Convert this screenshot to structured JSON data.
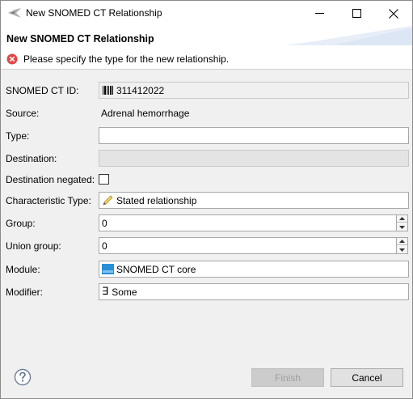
{
  "window": {
    "title": "New SNOMED CT Relationship",
    "app_icon": "snomed-logo-icon",
    "controls": [
      "minimize-icon",
      "maximize-icon",
      "close-icon"
    ]
  },
  "header": {
    "title": "New SNOMED CT Relationship",
    "error_message": "Please specify the type for the new relationship.",
    "error_icon": "error-icon",
    "error_color": "#e04848"
  },
  "form": {
    "id": {
      "label": "SNOMED CT ID:",
      "value": "311412022",
      "icon": "barcode-icon"
    },
    "source": {
      "label": "Source:",
      "value": "Adrenal hemorrhage"
    },
    "type": {
      "label": "Type:",
      "value": ""
    },
    "destination": {
      "label": "Destination:",
      "value": ""
    },
    "destination_negated": {
      "label": "Destination negated:",
      "checked": false
    },
    "characteristic_type": {
      "label": "Characteristic Type:",
      "value": "Stated relationship",
      "icon": "pencil-icon"
    },
    "group": {
      "label": "Group:",
      "value": "0"
    },
    "union_group": {
      "label": "Union group:",
      "value": "0"
    },
    "module": {
      "label": "Module:",
      "value": "SNOMED CT core",
      "icon": "module-icon"
    },
    "modifier": {
      "label": "Modifier:",
      "value": "Some",
      "glyph": "∃"
    }
  },
  "footer": {
    "help_icon": "help-icon",
    "finish_label": "Finish",
    "cancel_label": "Cancel"
  }
}
